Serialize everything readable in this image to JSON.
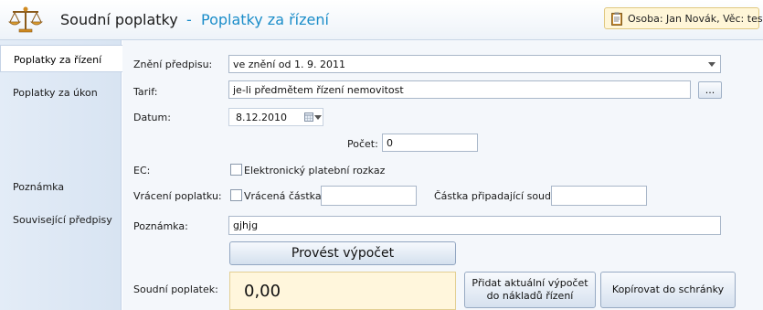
{
  "header": {
    "title": "Soudní poplatky",
    "separator": "-",
    "subtitle": "Poplatky za řízení",
    "person_info": "Osoba: Jan Novák, Věc: test"
  },
  "nav": {
    "items": [
      {
        "label": "Poplatky za řízení",
        "active": true
      },
      {
        "label": "Poplatky za úkon",
        "active": false
      },
      {
        "label": "Poznámka",
        "active": false
      },
      {
        "label": "Související předpisy",
        "active": false
      }
    ]
  },
  "form": {
    "zneni_label": "Znění předpisu:",
    "zneni_value": "ve znění od 1. 9. 2011",
    "tarif_label": "Tarif:",
    "tarif_value": "je-li předmětem řízení nemovitost",
    "tarif_browse_label": "...",
    "datum_label": "Datum:",
    "datum_value": "8.12.2010",
    "pocet_label": "Počet:",
    "pocet_value": "0",
    "ec_label": "EC:",
    "ec_checkbox_label": "Elektronický platební rozkaz",
    "vraceni_label": "Vrácení poplatku:",
    "vracena_castka_label": "Vrácená částka:",
    "vracena_castka_value": "",
    "castka_soudu_label": "Částka připadající soudu:",
    "castka_soudu_value": "",
    "poznamka_label": "Poznámka:",
    "poznamka_value": "gjhjg",
    "calculate_label": "Provést výpočet",
    "soudni_poplatek_label": "Soudní poplatek:",
    "soudni_poplatek_value": "0,00",
    "add_to_costs_line1": "Přidat aktuální výpočet",
    "add_to_costs_line2": "do nákladů řízení",
    "copy_label": "Kopírovat do schránky"
  },
  "colors": {
    "accent": "#1b8dc9",
    "result_bg": "#fff6dc"
  }
}
